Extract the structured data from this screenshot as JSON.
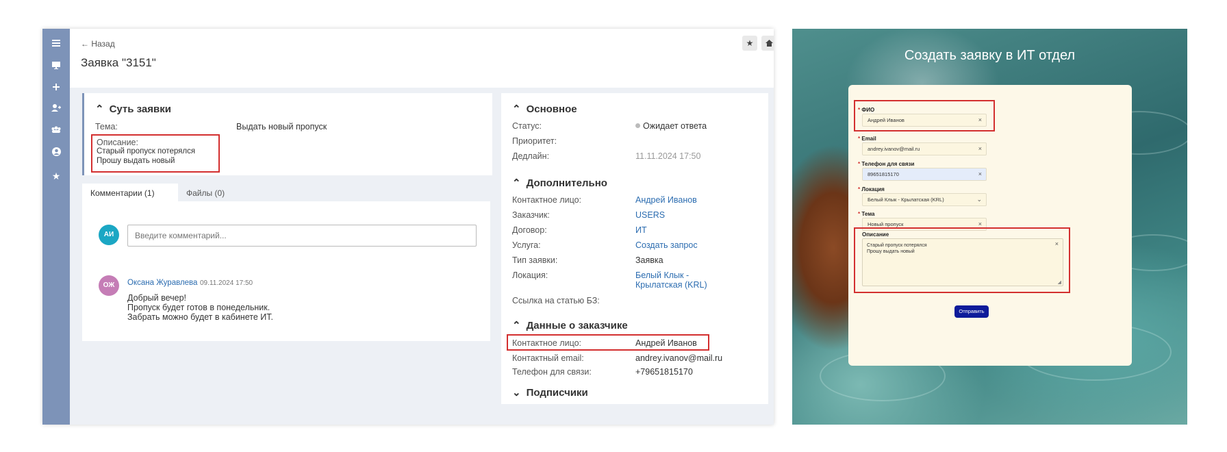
{
  "left_app": {
    "back_label": "← Назад",
    "page_title": "Заявка \"3151\"",
    "sidebar_icons": [
      "menu-icon",
      "monitor-icon",
      "plus-icon",
      "add-user-icon",
      "team-icon",
      "account-icon",
      "star-icon"
    ],
    "essence": {
      "header": "Суть заявки",
      "topic_label": "Тема:",
      "topic_value": "Выдать новый пропуск",
      "description_label": "Описание:",
      "description_line1": "Старый пропуск потерялся",
      "description_line2": "Прошу выдать новый"
    },
    "tabs": [
      "Комментарии (1)",
      "Файлы (0)"
    ],
    "comment_input": {
      "avatar": "АИ",
      "placeholder": "Введите комментарий..."
    },
    "comment": {
      "avatar": "ОЖ",
      "author": "Оксана Журавлева",
      "date": "09.11.2024 17:50",
      "line1": "Добрый вечер!",
      "line2": "Пропуск будет готов в понедельник.",
      "line3": "Забрать можно будет в кабинете ИТ."
    },
    "main": {
      "header": "Основное",
      "status_label": "Статус:",
      "status_value": "Ожидает ответа",
      "priority_label": "Приоритет:",
      "deadline_label": "Дедлайн:",
      "deadline_value": "11.11.2024 17:50"
    },
    "extra": {
      "header": "Дополнительно",
      "contact_label": "Контактное лицо:",
      "contact_value": "Андрей Иванов",
      "customer_label": "Заказчик:",
      "customer_value": "USERS",
      "contract_label": "Договор:",
      "contract_value": "ИТ",
      "service_label": "Услуга:",
      "service_value": "Создать запрос",
      "type_label": "Тип заявки:",
      "type_value": "Заявка",
      "location_label": "Локация:",
      "location_value1": "Белый Клык -",
      "location_value2": "Крылатская (KRL)",
      "kb_label": "Ссылка на статью БЗ:"
    },
    "customer_data": {
      "header": "Данные о заказчике",
      "contact_label": "Контактное лицо:",
      "contact_value": "Андрей Иванов",
      "email_label": "Контактный email:",
      "email_value": "andrey.ivanov@mail.ru",
      "phone_label": "Телефон для связи:",
      "phone_value": "+79651815170"
    },
    "subscribers": {
      "header": "Подписчики"
    }
  },
  "right_form": {
    "title": "Создать заявку в ИТ отдел",
    "fields": {
      "fio_label": "ФИО",
      "fio_value": "Андрей Иванов",
      "email_label": "Email",
      "email_value": "andrey.ivanov@mail.ru",
      "phone_label": "Телефон для связи",
      "phone_value": "89651815170",
      "location_label": "Локация",
      "location_value": "Белый Клык - Крылатская (KRL)",
      "topic_label": "Тема",
      "topic_value": "Новый пропуск",
      "description_label": "Описание",
      "description_line1": "Старый пропуск потерялся",
      "description_line2": "Прошу выдать новый"
    },
    "required_mark": "*",
    "submit_label": "Отправить"
  },
  "colors": {
    "sidebar": "#7d93b8",
    "link": "#2b6cb0",
    "highlight": "#d32f2f",
    "submit": "#0d1b9a"
  }
}
